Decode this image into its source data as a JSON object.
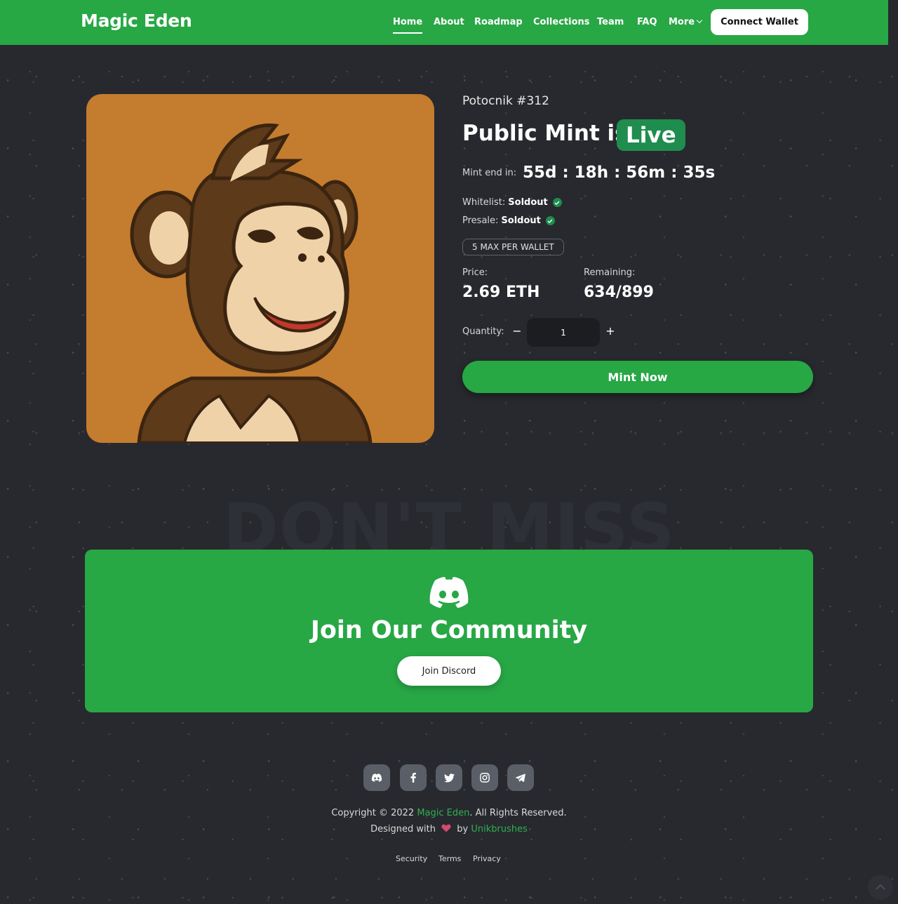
{
  "header": {
    "logo": "Magic Eden",
    "nav": [
      "Home",
      "About",
      "Roadmap",
      "Collections",
      "Team",
      "FAQ",
      "More"
    ],
    "active_nav": "Home",
    "connect_wallet": "Connect Wallet"
  },
  "mint": {
    "collection_name": "Potocnik #312",
    "title": "Public Mint is",
    "live_label": "Live",
    "mint_end_label": "Mint end in:",
    "countdown": "55d : 18h : 56m : 35s",
    "whitelist_label": "Whitelist:",
    "whitelist_status": "Soldout",
    "presale_label": "Presale:",
    "presale_status": "Soldout",
    "max_per_wallet": "5 MAX PER WALLET",
    "price_label": "Price:",
    "price_value": "2.69 ETH",
    "remaining_label": "Remaining:",
    "remaining_value": "634/899",
    "quantity_label": "Quantity:",
    "quantity_minus": "−",
    "quantity_value": "1",
    "quantity_plus": "+",
    "mint_button": "Mint Now"
  },
  "dont_miss": "DON'T MISS",
  "community": {
    "title": "Join Our Community",
    "button": "Join Discord"
  },
  "footer": {
    "socials": [
      "discord-icon",
      "facebook-icon",
      "twitter-icon",
      "instagram-icon",
      "telegram-icon"
    ],
    "copyright_prefix": "Copyright © 2022",
    "copyright_brand": "Magic Eden",
    "copyright_suffix": ". All Rights Reserved.",
    "designed_prefix": "Designed with",
    "designed_by": "by",
    "designer": "Unikbrushes",
    "links": [
      "Security",
      "Terms",
      "Privacy"
    ]
  },
  "colors": {
    "brand_green": "#28a745",
    "background": "#27292e",
    "live_badge": "#1e8d4d",
    "nft_background": "#c47c2e"
  }
}
